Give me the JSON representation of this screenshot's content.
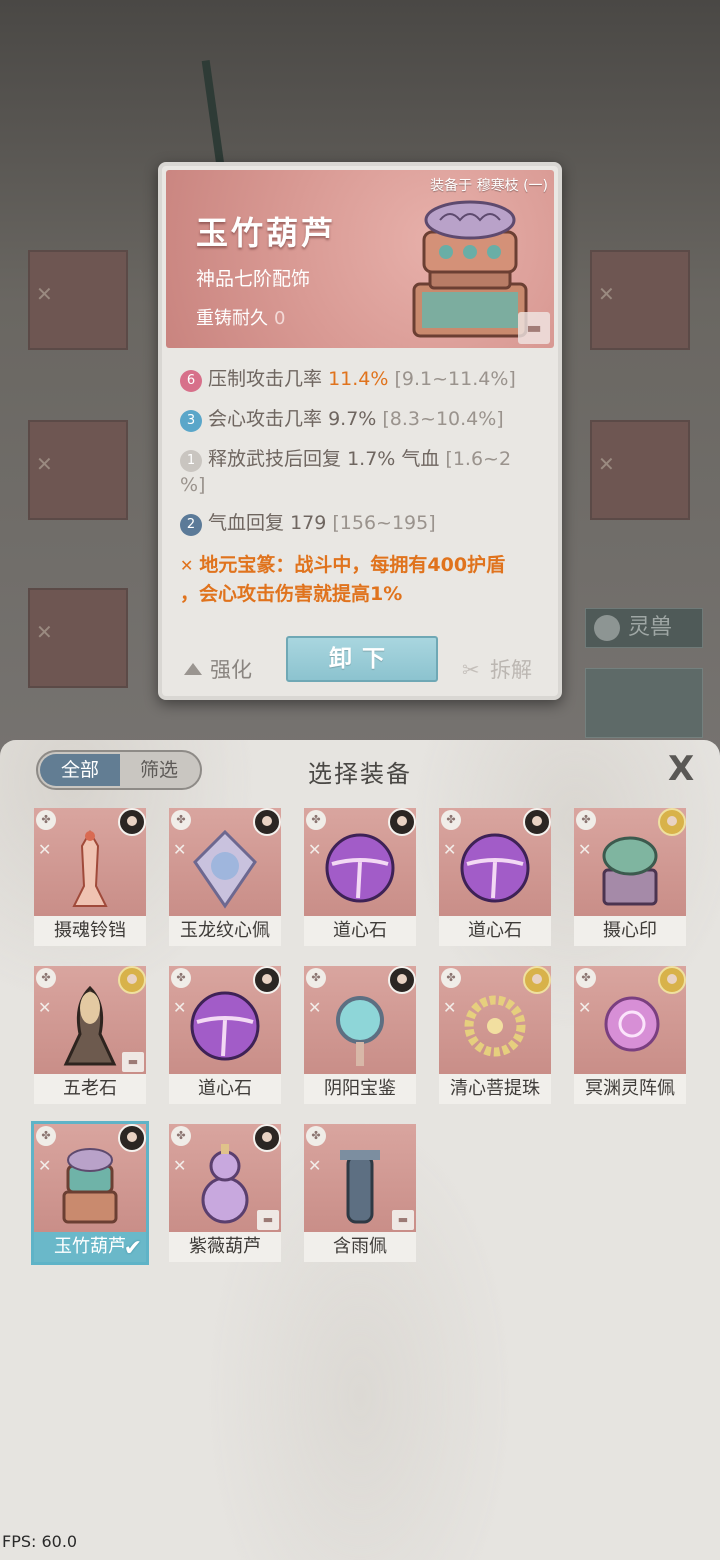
{
  "detail": {
    "equipped_by": "装备于 穆寒枝 (一)",
    "name": "玉竹葫芦",
    "grade": "神品七阶配饰",
    "recast_label": "重铸耐久",
    "recast_value": "0",
    "stats": [
      {
        "badge": "6",
        "label": "压制攻击几率",
        "value": "11.4%",
        "range": "[9.1~11.4%]",
        "badge_color": "#d7708a",
        "highlight": true
      },
      {
        "badge": "3",
        "label": "会心攻击几率",
        "value": "9.7%",
        "range": "[8.3~10.4%]",
        "badge_color": "#5aa6c9",
        "highlight": false
      },
      {
        "badge": "1",
        "label": "释放武技后回复",
        "value": "1.7% 气血",
        "range": "[1.6~2",
        "range2": "%]",
        "badge_color": "#c9c5c0",
        "highlight": false
      },
      {
        "badge": "2",
        "label": "气血回复",
        "value": "179",
        "range": "[156~195]",
        "badge_color": "#5b7a98",
        "highlight": false
      }
    ],
    "set_effect_line1": "地元宝篆：战斗中，每拥有400护盾",
    "set_effect_line2": "，会心攻击伤害就提高1%",
    "strengthen_label": "强化",
    "unequip_label": "卸下",
    "dismantle_label": "拆解"
  },
  "background": {
    "lingshou_label": "灵兽"
  },
  "panel": {
    "tab_all": "全部",
    "tab_filter": "筛选",
    "title": "选择装备",
    "close_symbol": "X",
    "items": [
      {
        "name": "摄魂铃铛"
      },
      {
        "name": "玉龙纹心佩"
      },
      {
        "name": "道心石"
      },
      {
        "name": "道心石"
      },
      {
        "name": "摄心印"
      },
      {
        "name": "五老石"
      },
      {
        "name": "道心石"
      },
      {
        "name": "阴阳宝鉴"
      },
      {
        "name": "清心菩提珠"
      },
      {
        "name": "冥渊灵阵佩"
      },
      {
        "name": "玉竹葫芦"
      },
      {
        "name": "紫薇葫芦"
      },
      {
        "name": "含雨佩"
      }
    ]
  },
  "fps": "FPS: 60.0"
}
